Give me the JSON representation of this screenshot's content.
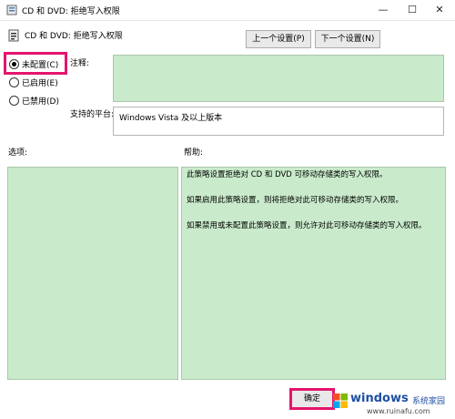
{
  "window": {
    "title": "CD 和 DVD: 拒绝写入权限",
    "controls": {
      "minimize": "—",
      "maximize": "☐",
      "close": "✕"
    }
  },
  "header": {
    "policy_title": "CD 和 DVD: 拒绝写入权限",
    "prev_button": "上一个设置(P)",
    "next_button": "下一个设置(N)"
  },
  "radios": [
    {
      "label": "未配置(C)",
      "checked": true
    },
    {
      "label": "已启用(E)",
      "checked": false
    },
    {
      "label": "已禁用(D)",
      "checked": false
    }
  ],
  "comment_label": "注释:",
  "platform": {
    "label": "支持的平台:",
    "value": "Windows Vista 及以上版本"
  },
  "options_label": "选项:",
  "help_label": "帮助:",
  "help_lines": [
    "此策略设置拒绝对 CD 和 DVD 可移动存储类的写入权限。",
    "如果启用此策略设置，则将拒绝对此可移动存储类的写入权限。",
    "如果禁用或未配置此策略设置，则允许对此可移动存储类的写入权限。"
  ],
  "ok_button": "确定",
  "watermark": {
    "text": "windows",
    "cn": "系统家园",
    "url": "www.ruinafu.com"
  },
  "colors": {
    "highlight": "#e4156c",
    "panel_green": "#c9ebcb"
  }
}
